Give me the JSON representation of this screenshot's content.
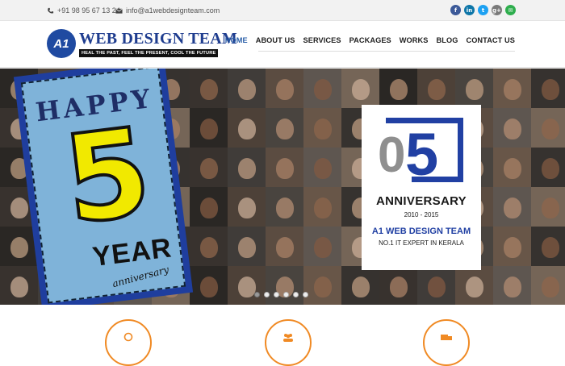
{
  "topbar": {
    "phone_icon": "phone-icon",
    "phone": "+91 98 95 67 13 24",
    "email_icon": "envelope-icon",
    "email": "info@a1webdesignteam.com",
    "social": [
      {
        "icon": "facebook-icon",
        "glyph": "f",
        "color": "#3b5998"
      },
      {
        "icon": "linkedin-icon",
        "glyph": "in",
        "color": "#0e76a8"
      },
      {
        "icon": "twitter-icon",
        "glyph": "t",
        "color": "#1da1f2"
      },
      {
        "icon": "google-plus-icon",
        "glyph": "g+",
        "color": "#7a7a7a"
      },
      {
        "icon": "mail-icon",
        "glyph": "✉",
        "color": "#2fae4e"
      }
    ]
  },
  "logo": {
    "mark": "A1",
    "brand": "WEB DESIGN TEAM",
    "tagline": "HEAL THE PAST, FEEL THE PRESENT, COOL THE FUTURE",
    "brand_color": "#1f3d8f"
  },
  "nav": {
    "items": [
      "HOME",
      "ABOUT US",
      "SERVICES",
      "PACKAGES",
      "WORKS",
      "BLOG",
      "CONTACT US"
    ],
    "active": "HOME",
    "active_color": "#2a5fa8"
  },
  "hero": {
    "card": {
      "happy": "HAPPY",
      "number": "5",
      "year": "YEAR",
      "script": "anniversary"
    },
    "badge": {
      "zero": "0",
      "five": "5",
      "anniversary": "ANNIVERSARY",
      "years": "2010 - 2015",
      "company": "A1 WEB DESIGN TEAM",
      "tagline": "NO.1 IT EXPERT IN KERALA",
      "accent": "#2140a3"
    },
    "slider": {
      "count": 6,
      "active_index": 0
    }
  },
  "services": {
    "accent": "#f08a24",
    "icons": [
      "lightbulb-icon",
      "users-icon",
      "truck-icon"
    ]
  }
}
